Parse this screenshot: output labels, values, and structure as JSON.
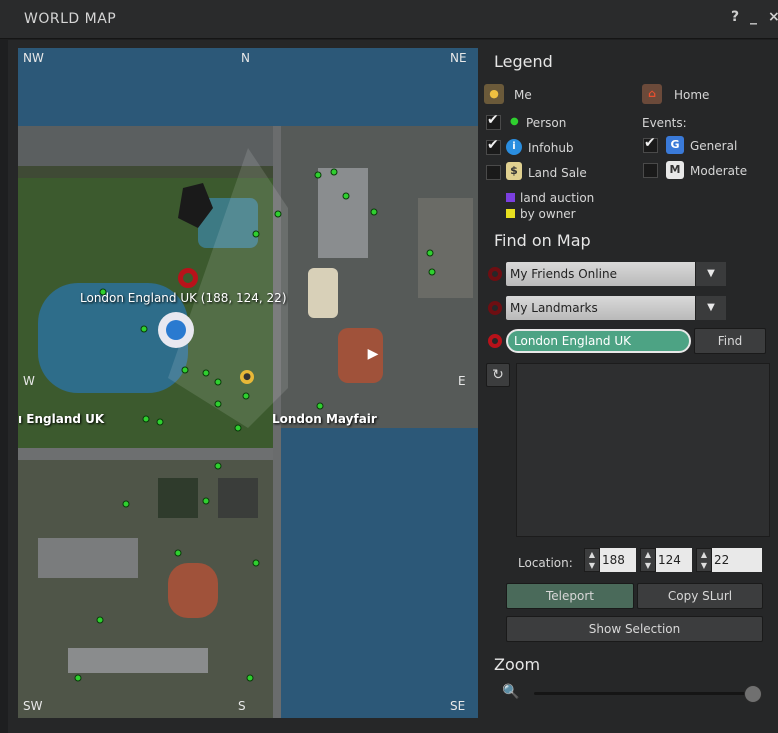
{
  "window": {
    "title": "WORLD MAP",
    "help": "?",
    "minimize": "_",
    "close": "×"
  },
  "map": {
    "compass": {
      "nw": "NW",
      "n": "N",
      "ne": "NE",
      "w": "W",
      "e": "E",
      "sw": "SW",
      "s": "S",
      "se": "SE"
    },
    "labels": {
      "selection": "London England UK (188, 124, 22)",
      "region_west": "ı England UK",
      "region_east": "London Mayfair"
    }
  },
  "legend": {
    "heading": "Legend",
    "me": "Me",
    "home": "Home",
    "person": "Person",
    "infohub": "Infohub",
    "land_sale": "Land Sale",
    "land_auction": "land auction",
    "by_owner": "by owner",
    "events": "Events:",
    "general": "General",
    "moderate": "Moderate"
  },
  "find": {
    "heading": "Find on Map",
    "friends_select": "My Friends Online",
    "landmarks_select": "My Landmarks",
    "search_value": "London England UK",
    "find_button": "Find"
  },
  "location": {
    "label": "Location:",
    "x": "188",
    "y": "124",
    "z": "22"
  },
  "actions": {
    "teleport": "Teleport",
    "copy_slurl": "Copy SLurl",
    "show_selection": "Show Selection"
  },
  "zoom": {
    "heading": "Zoom",
    "level": 0.97
  },
  "colors": {
    "accent_ring": "#b8121a",
    "search_bg": "#4da384",
    "land_auction": "#7b3fe0",
    "by_owner": "#e8e020",
    "person_dot": "#2fd02f"
  }
}
